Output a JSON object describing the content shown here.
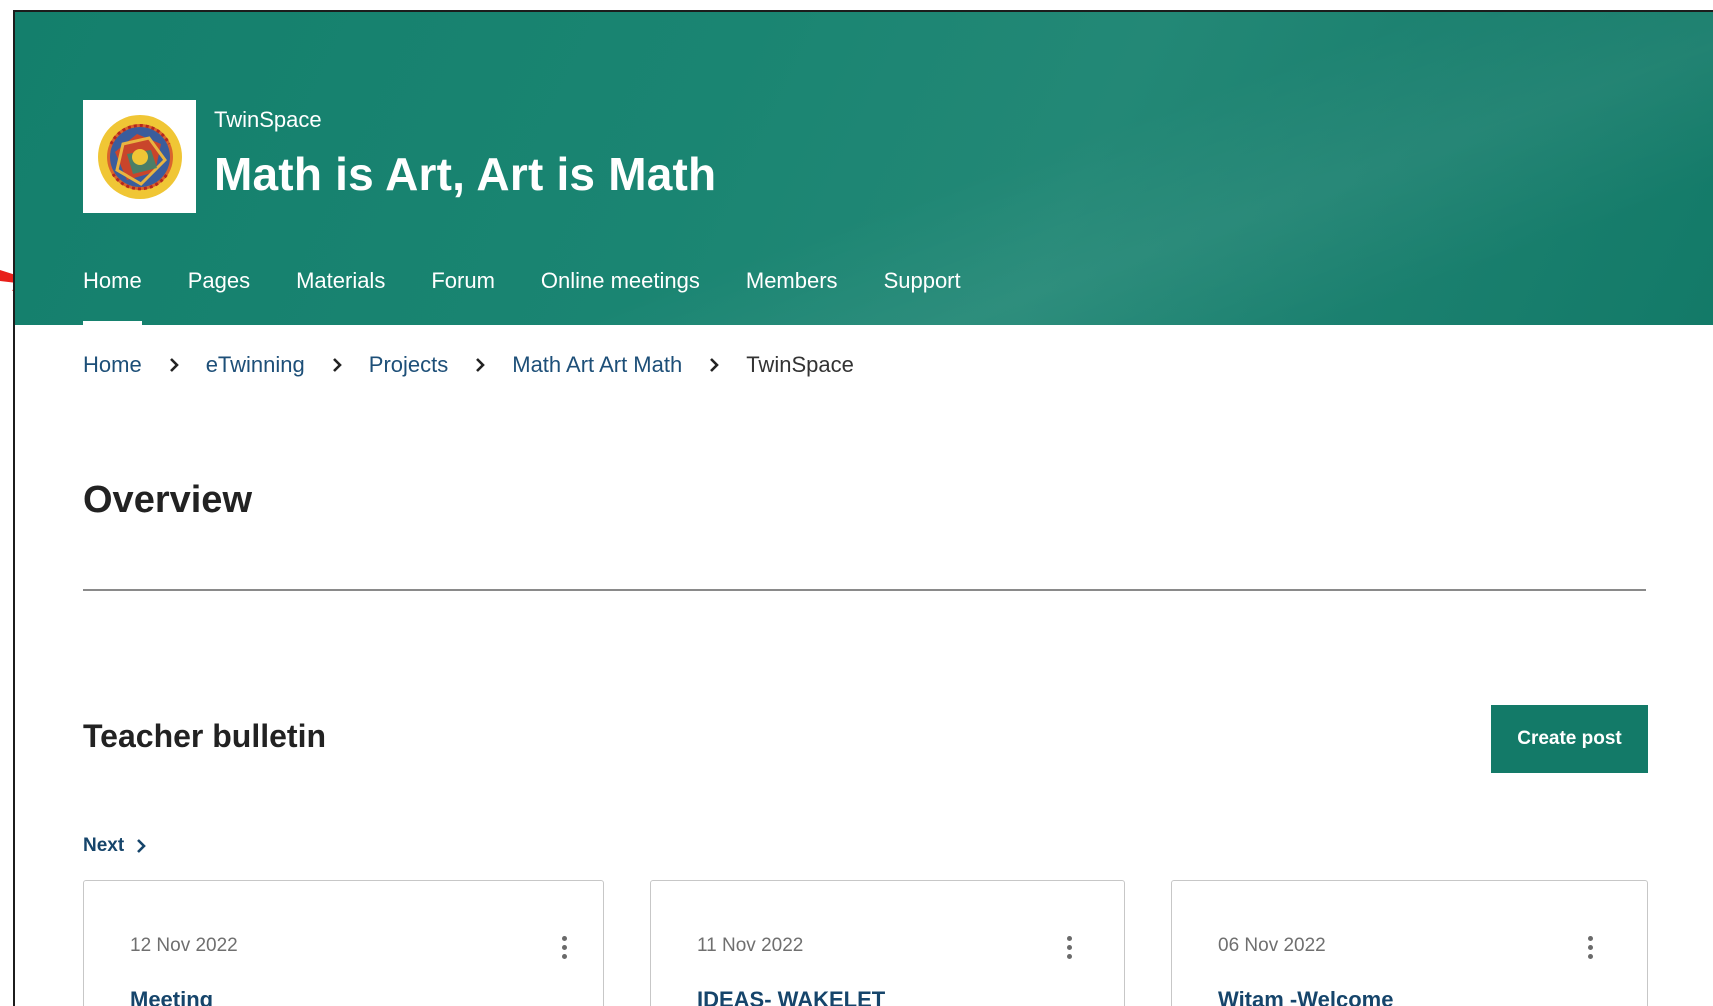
{
  "header": {
    "site_label": "TwinSpace",
    "title": "Math is Art, Art is Math",
    "logo_text": "MATH IS ART ART IS MATH"
  },
  "nav": {
    "items": [
      {
        "label": "Home",
        "active": true
      },
      {
        "label": "Pages"
      },
      {
        "label": "Materials"
      },
      {
        "label": "Forum"
      },
      {
        "label": "Online meetings"
      },
      {
        "label": "Members"
      },
      {
        "label": "Support"
      }
    ]
  },
  "breadcrumb": {
    "items": [
      "Home",
      "eTwinning",
      "Projects",
      "Math Art Art Math",
      "TwinSpace"
    ]
  },
  "overview": {
    "title": "Overview"
  },
  "bulletin": {
    "title": "Teacher bulletin",
    "create_label": "Create post",
    "next_label": "Next",
    "posts": [
      {
        "date": "12 Nov 2022",
        "title": "Meeting"
      },
      {
        "date": "11 Nov 2022",
        "title": "IDEAS- WAKELET"
      },
      {
        "date": "06 Nov 2022",
        "title": "Witam -Welcome"
      }
    ]
  },
  "colors": {
    "header_bg": "#1a8572",
    "accent": "#137a68",
    "link": "#1d4f78",
    "annotation_arrow": "#e8201a"
  },
  "icons": [
    "chevron-right-icon",
    "more-vertical-icon",
    "annotation-arrow-icon"
  ]
}
